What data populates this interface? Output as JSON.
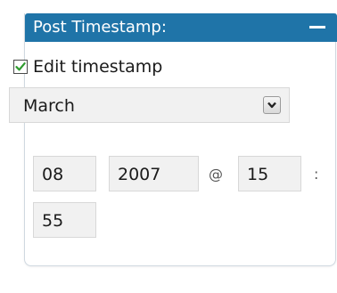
{
  "panel": {
    "title": "Post Timestamp:",
    "collapse_icon": "minus-icon",
    "accent_color": "#1f74a8"
  },
  "edit_timestamp": {
    "label": "Edit timestamp",
    "checked": true
  },
  "month_select": {
    "selected": "March",
    "icon": "chevron-down-icon"
  },
  "day": "08",
  "year": "2007",
  "at_separator": "@",
  "hour": "15",
  "colon_separator": ":",
  "minute": "55"
}
